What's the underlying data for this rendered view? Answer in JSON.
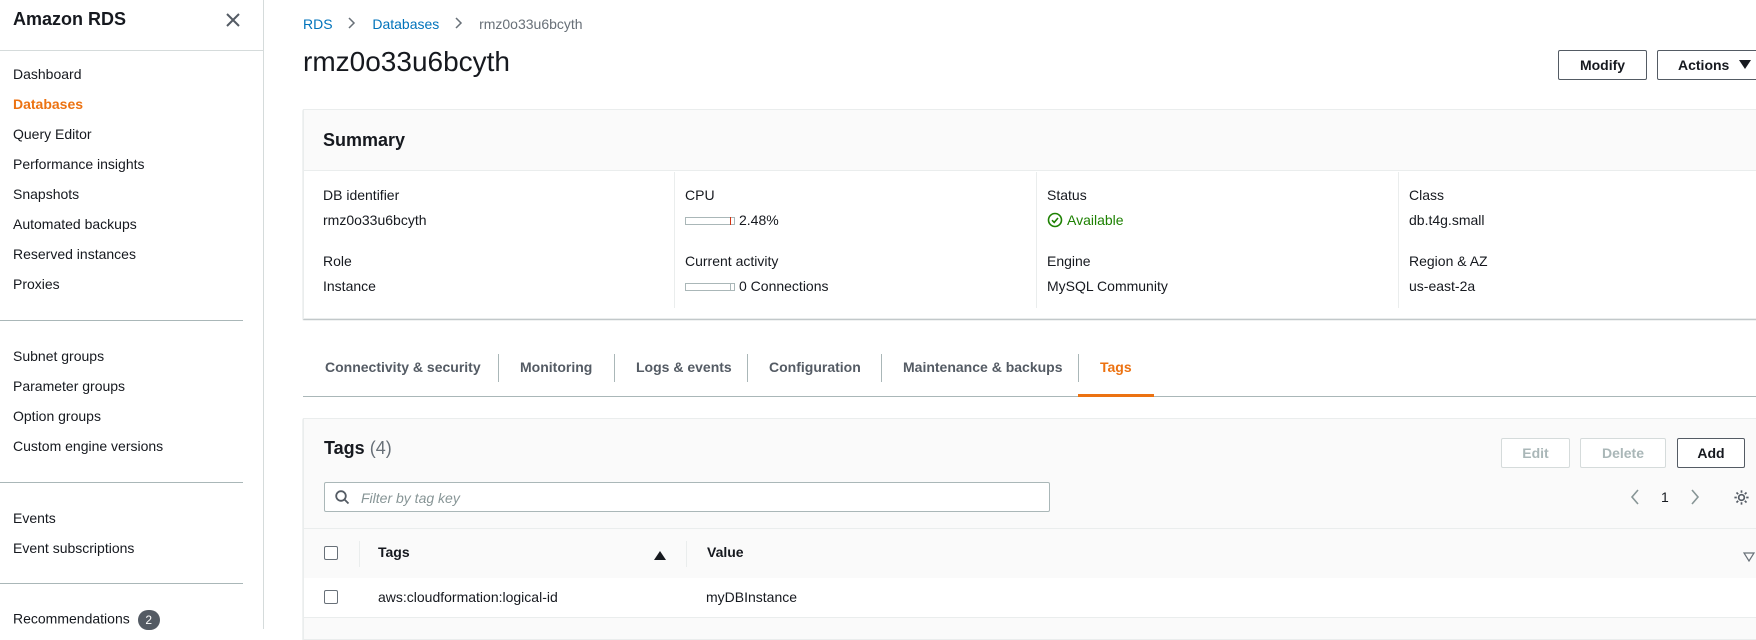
{
  "sidebar": {
    "title": "Amazon RDS",
    "items": [
      {
        "label": "Dashboard"
      },
      {
        "label": "Databases"
      },
      {
        "label": "Query Editor"
      },
      {
        "label": "Performance insights"
      },
      {
        "label": "Snapshots"
      },
      {
        "label": "Automated backups"
      },
      {
        "label": "Reserved instances"
      },
      {
        "label": "Proxies"
      },
      {
        "label": "Subnet groups"
      },
      {
        "label": "Parameter groups"
      },
      {
        "label": "Option groups"
      },
      {
        "label": "Custom engine versions"
      },
      {
        "label": "Events"
      },
      {
        "label": "Event subscriptions"
      },
      {
        "label": "Recommendations"
      }
    ],
    "recommendations_badge": "2",
    "active_item": "Databases"
  },
  "breadcrumb": {
    "items": [
      "RDS",
      "Databases",
      "rmz0o33u6bcyth"
    ]
  },
  "page": {
    "title": "rmz0o33u6bcyth",
    "modify_label": "Modify",
    "actions_label": "Actions"
  },
  "summary": {
    "heading": "Summary",
    "fields": {
      "db_identifier": {
        "label": "DB identifier",
        "value": "rmz0o33u6bcyth"
      },
      "role": {
        "label": "Role",
        "value": "Instance"
      },
      "cpu": {
        "label": "CPU",
        "value": "2.48%"
      },
      "current_activity": {
        "label": "Current activity",
        "value": "0 Connections"
      },
      "status": {
        "label": "Status",
        "value": "Available"
      },
      "engine": {
        "label": "Engine",
        "value": "MySQL Community"
      },
      "class": {
        "label": "Class",
        "value": "db.t4g.small"
      },
      "region_az": {
        "label": "Region & AZ",
        "value": "us-east-2a"
      }
    }
  },
  "tabs": [
    {
      "label": "Connectivity & security"
    },
    {
      "label": "Monitoring"
    },
    {
      "label": "Logs & events"
    },
    {
      "label": "Configuration"
    },
    {
      "label": "Maintenance & backups"
    },
    {
      "label": "Tags"
    }
  ],
  "active_tab": "Tags",
  "tags_panel": {
    "title": "Tags",
    "count": "(4)",
    "edit_label": "Edit",
    "delete_label": "Delete",
    "add_label": "Add",
    "filter_placeholder": "Filter by tag key",
    "page_number": "1",
    "columns": [
      "Tags",
      "Value"
    ],
    "rows": [
      {
        "key": "aws:cloudformation:logical-id",
        "value": "myDBInstance"
      }
    ]
  },
  "colors": {
    "accent": "#ec7211",
    "link": "#0073bb",
    "success": "#1d8102"
  }
}
